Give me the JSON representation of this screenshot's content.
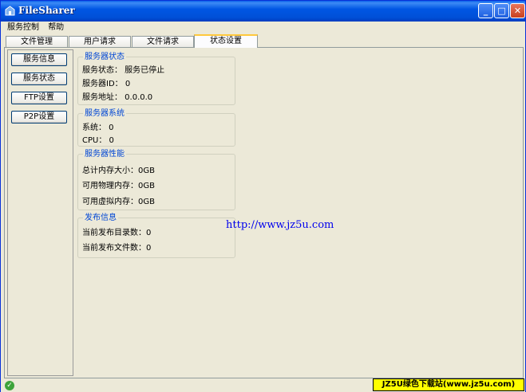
{
  "window": {
    "title": "FileSharer"
  },
  "menu": [
    "服务控制",
    "帮助"
  ],
  "tabs": [
    {
      "label": "文件管理"
    },
    {
      "label": "用户请求"
    },
    {
      "label": "文件请求"
    },
    {
      "label": "状态设置",
      "active": true
    }
  ],
  "sidebar": [
    "服务信息",
    "服务状态",
    "FTP设置",
    "P2P设置"
  ],
  "groups": {
    "status": {
      "title": "服务器状态",
      "rows": [
        "服务状态：  服务已停止",
        "服务器ID：  0",
        "服务地址：  0.0.0.0"
      ]
    },
    "system": {
      "title": "服务器系统",
      "rows": [
        "系统：  0",
        "CPU：   0"
      ]
    },
    "perf": {
      "title": "服务器性能",
      "rows": [
        "总计内存大小：0GB",
        "可用物理内存：0GB",
        "可用虚拟内存：0GB"
      ]
    },
    "publish": {
      "title": "发布信息",
      "rows": [
        "当前发布目录数：0",
        "当前发布文件数：0"
      ]
    }
  },
  "url_text": "http://www.jz5u.com",
  "watermark": "JZ5U绿色下载站(www.jz5u.com)",
  "colors": {
    "titlebar": "#0054E3",
    "group_title": "#0046D5",
    "active_tab_accent": "#FFC83C"
  }
}
